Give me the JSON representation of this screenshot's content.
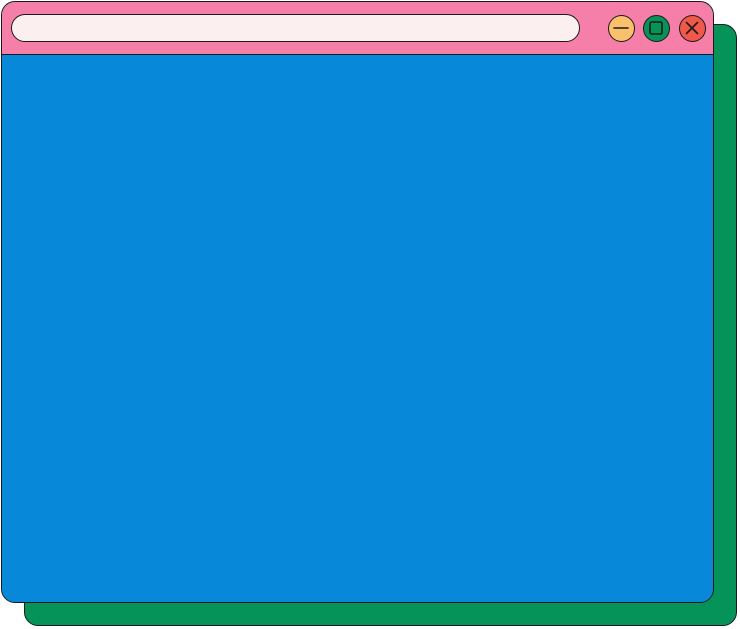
{
  "window": {
    "address_value": "",
    "controls": [
      {
        "name": "minimize",
        "icon": "minimize-icon"
      },
      {
        "name": "maximize",
        "icon": "maximize-icon"
      },
      {
        "name": "close",
        "icon": "close-icon"
      }
    ]
  },
  "colors": {
    "titlebar": "#f57fa9",
    "address_bar": "#fbf0ef",
    "content": "#0788d8",
    "back_window": "#06935a",
    "minimize": "#fbc06e",
    "maximize": "#05935a",
    "close": "#f0584a",
    "outline": "#1a1a1a"
  }
}
